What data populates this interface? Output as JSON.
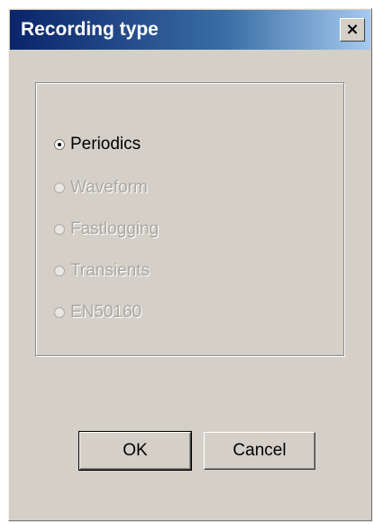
{
  "window": {
    "title": "Recording type",
    "close_symbol": "×"
  },
  "options": [
    {
      "label": "Periodics",
      "selected": true,
      "enabled": true
    },
    {
      "label": "Waveform",
      "selected": false,
      "enabled": false
    },
    {
      "label": "Fastlogging",
      "selected": false,
      "enabled": false
    },
    {
      "label": "Transients",
      "selected": false,
      "enabled": false
    },
    {
      "label": "EN50160",
      "selected": false,
      "enabled": false
    }
  ],
  "buttons": {
    "ok_label": "OK",
    "cancel_label": "Cancel"
  },
  "colors": {
    "titlebar_start": "#0a246a",
    "titlebar_end": "#a6caf0",
    "dialog_face": "#d4d0c8",
    "disabled_text": "#aaa8a3"
  }
}
